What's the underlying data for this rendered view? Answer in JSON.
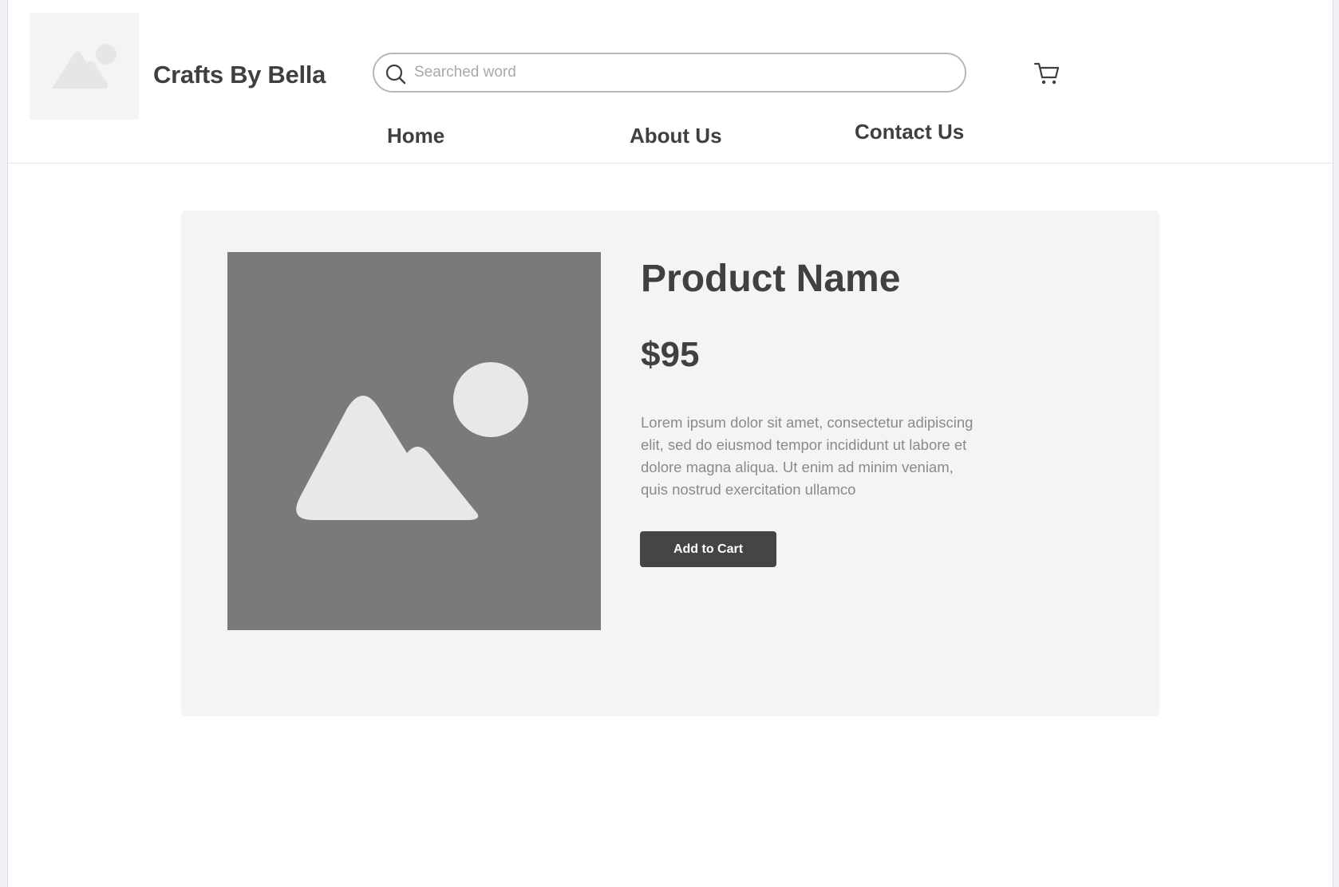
{
  "header": {
    "brand_name": "Crafts By Bella",
    "logo_icon": "image-placeholder-icon",
    "search": {
      "placeholder": "Searched word",
      "value": "",
      "icon": "search-icon"
    },
    "cart_icon": "cart-icon",
    "nav": [
      {
        "label": "Home"
      },
      {
        "label": "About Us"
      },
      {
        "label": "Contact Us"
      }
    ]
  },
  "product": {
    "name": "Product Name",
    "price": "$95",
    "description": "Lorem ipsum dolor sit amet, consectetur adipiscing elit, sed do eiusmod tempor incididunt ut labore et dolore magna aliqua. Ut enim ad minim veniam, quis nostrud exercitation ullamco",
    "image_icon": "image-placeholder-icon",
    "add_to_cart_label": "Add to Cart"
  },
  "colors": {
    "page_background": "#f1f0f4",
    "card_background": "#f5f4f5",
    "image_placeholder": "#7a7a7a",
    "primary_button": "#454545",
    "text_dark": "#404040",
    "text_muted": "#8a8a8a"
  }
}
